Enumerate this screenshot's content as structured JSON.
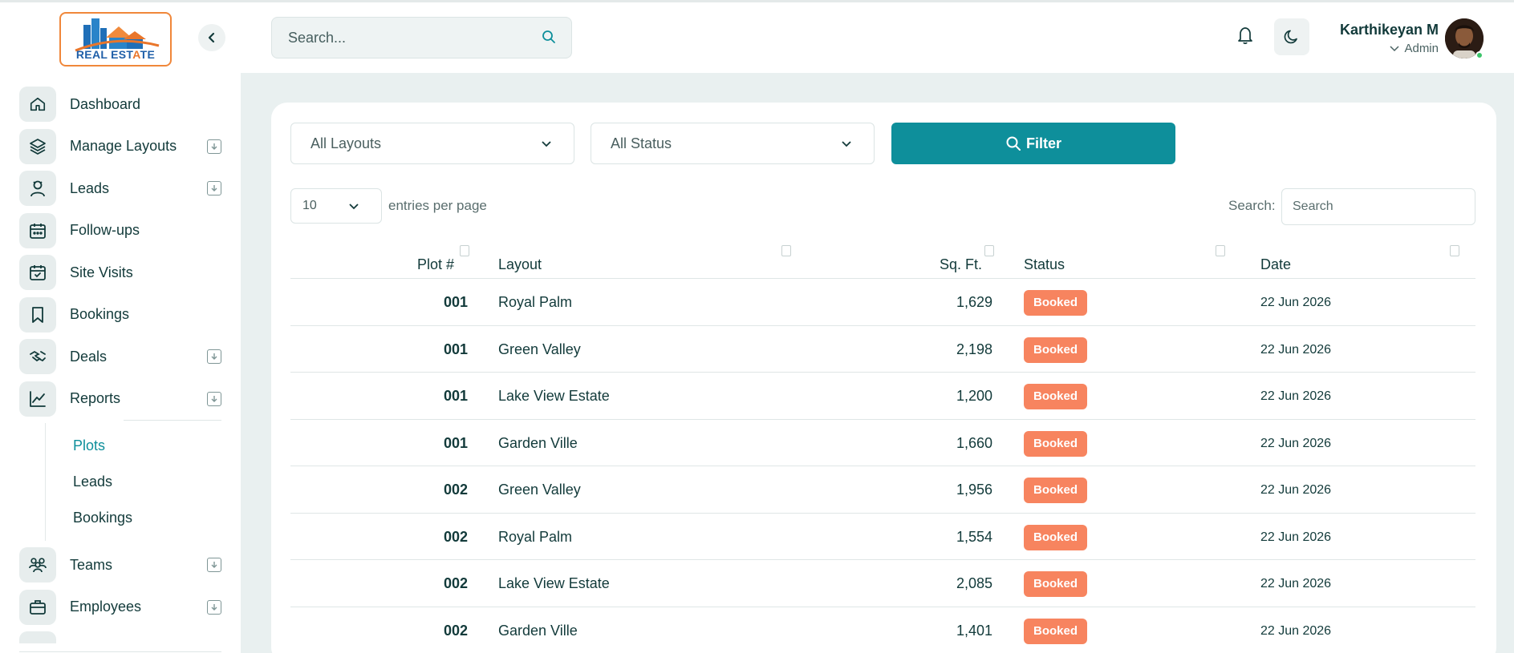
{
  "brand": {
    "logo_text_1": "REAL EST",
    "logo_text_2": "A",
    "logo_text_3": "TE"
  },
  "sidebar": {
    "items": [
      {
        "label": "Dashboard",
        "icon": "home-icon",
        "expandable": false
      },
      {
        "label": "Manage Layouts",
        "icon": "layers-icon",
        "expandable": true
      },
      {
        "label": "Leads",
        "icon": "person-icon",
        "expandable": true
      },
      {
        "label": "Follow-ups",
        "icon": "calendar-icon",
        "expandable": false
      },
      {
        "label": "Site Visits",
        "icon": "calendar-check-icon",
        "expandable": false
      },
      {
        "label": "Bookings",
        "icon": "bookmark-icon",
        "expandable": false
      },
      {
        "label": "Deals",
        "icon": "handshake-icon",
        "expandable": true
      },
      {
        "label": "Reports",
        "icon": "chart-line-icon",
        "expandable": true
      }
    ],
    "reports_sub": [
      {
        "label": "Plots",
        "active": true
      },
      {
        "label": "Leads",
        "active": false
      },
      {
        "label": "Bookings",
        "active": false
      }
    ],
    "items_after": [
      {
        "label": "Teams",
        "icon": "users-icon",
        "expandable": true
      },
      {
        "label": "Employees",
        "icon": "briefcase-icon",
        "expandable": true
      }
    ]
  },
  "header": {
    "search_placeholder": "Search...",
    "user_name": "Karthikeyan M",
    "user_role": "Admin"
  },
  "filters": {
    "layout_select": "All Layouts",
    "status_select": "All Status",
    "filter_label": "Filter"
  },
  "table_controls": {
    "entries_value": "10",
    "entries_label": "entries per page",
    "search_label": "Search:",
    "search_placeholder": "Search"
  },
  "table": {
    "columns": [
      "Plot #",
      "Layout",
      "Sq. Ft.",
      "Status",
      "Date"
    ],
    "rows": [
      {
        "plot": "001",
        "layout": "Royal Palm",
        "sqft": "1,629",
        "status": "Booked",
        "date": "22 Jun 2026"
      },
      {
        "plot": "001",
        "layout": "Green Valley",
        "sqft": "2,198",
        "status": "Booked",
        "date": "22 Jun 2026"
      },
      {
        "plot": "001",
        "layout": "Lake View Estate",
        "sqft": "1,200",
        "status": "Booked",
        "date": "22 Jun 2026"
      },
      {
        "plot": "001",
        "layout": "Garden Ville",
        "sqft": "1,660",
        "status": "Booked",
        "date": "22 Jun 2026"
      },
      {
        "plot": "002",
        "layout": "Green Valley",
        "sqft": "1,956",
        "status": "Booked",
        "date": "22 Jun 2026"
      },
      {
        "plot": "002",
        "layout": "Royal Palm",
        "sqft": "1,554",
        "status": "Booked",
        "date": "22 Jun 2026"
      },
      {
        "plot": "002",
        "layout": "Lake View Estate",
        "sqft": "2,085",
        "status": "Booked",
        "date": "22 Jun 2026"
      },
      {
        "plot": "002",
        "layout": "Garden Ville",
        "sqft": "1,401",
        "status": "Booked",
        "date": "22 Jun 2026"
      }
    ]
  },
  "colors": {
    "accent": "#0e8f9b",
    "badge": "#f7845f",
    "main_bg": "#e9f0f0",
    "text": "#123a3a"
  }
}
